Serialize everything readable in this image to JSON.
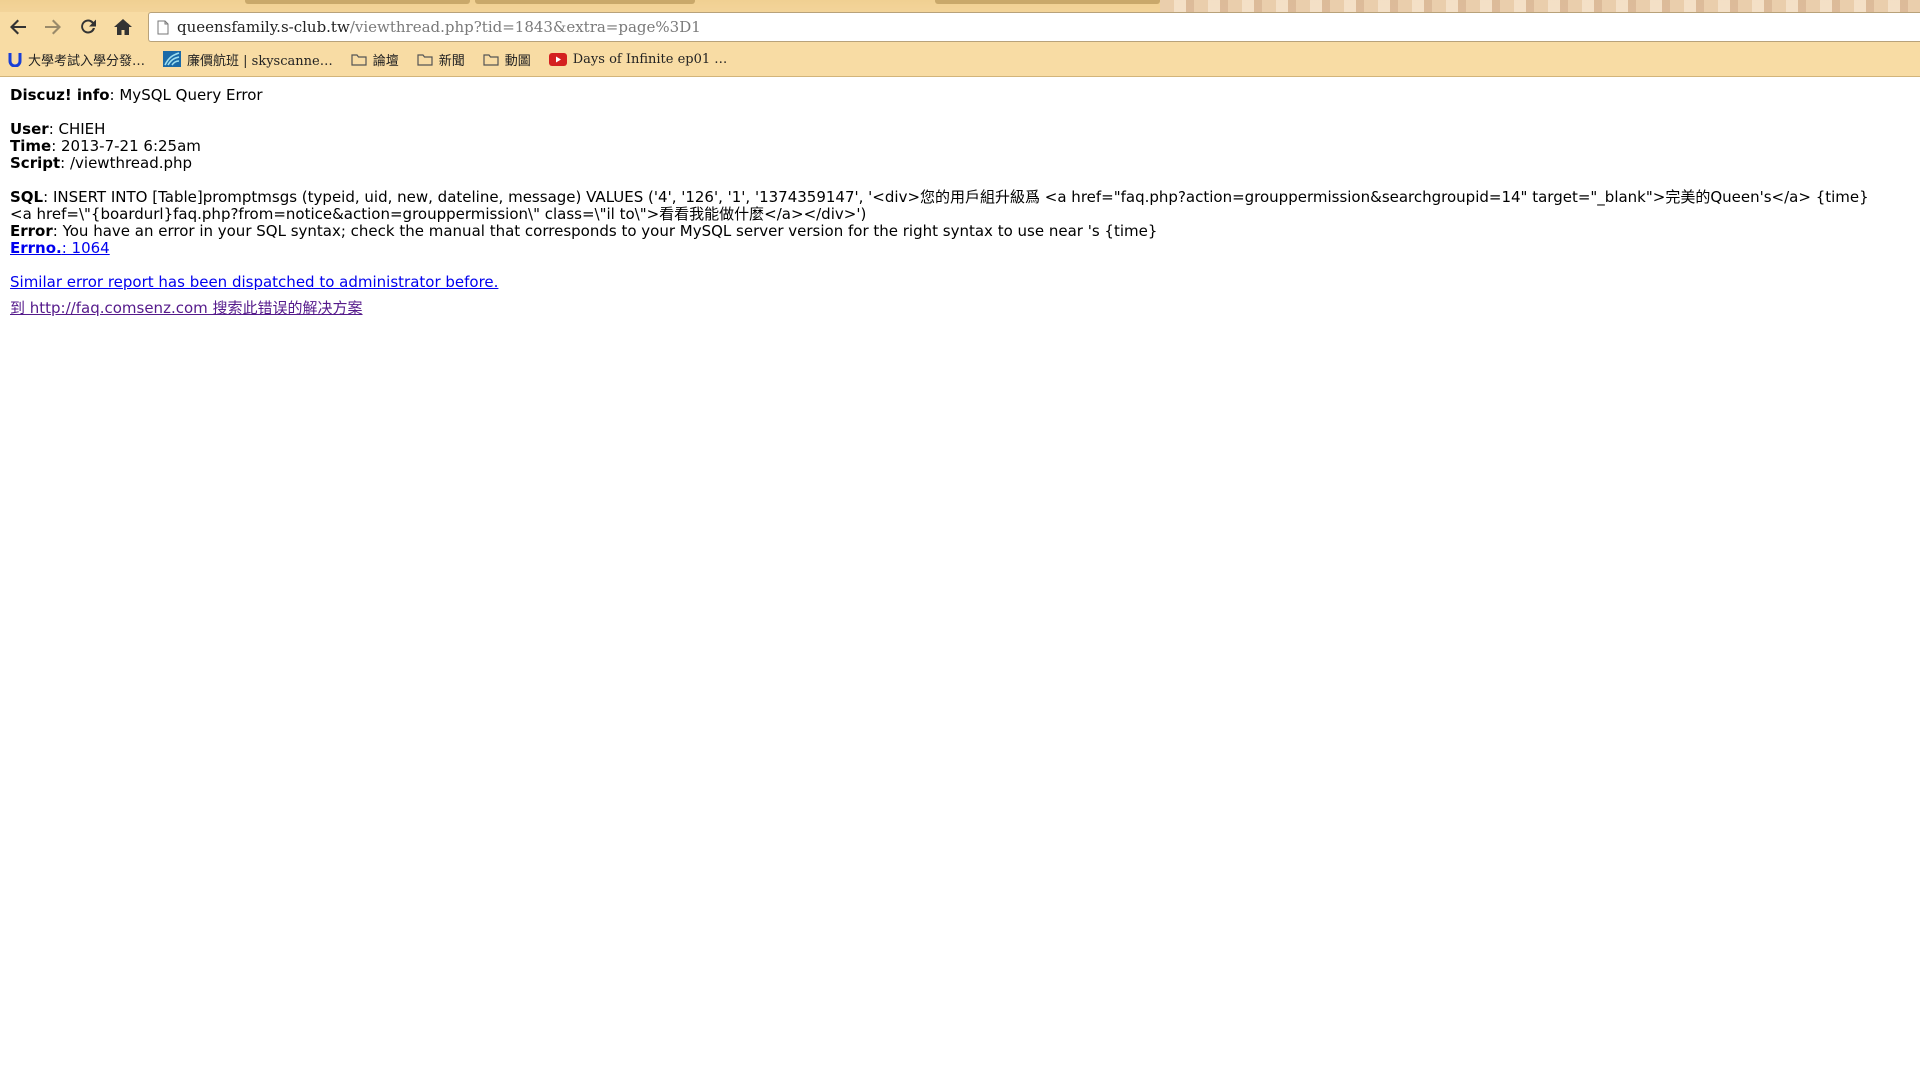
{
  "browser": {
    "url_host": "queensfamily.s-club.tw",
    "url_path": "/viewthread.php?tid=1843&extra=page%3D1",
    "bookmarks": [
      {
        "label": "大學考試入學分發…",
        "icon": "u-logo-icon"
      },
      {
        "label": "廉價航班 | skyscanne…",
        "icon": "skyscanner-icon"
      },
      {
        "label": "論壇",
        "icon": "folder-icon"
      },
      {
        "label": "新聞",
        "icon": "folder-icon"
      },
      {
        "label": "動圖",
        "icon": "folder-icon"
      },
      {
        "label": "Days of Infinite ep01 …",
        "icon": "youtube-icon"
      }
    ],
    "accent_color": "#f8dca4"
  },
  "error": {
    "title_label": "Discuz! info",
    "title_text": ": MySQL Query Error",
    "user_label": "User",
    "user_value": ": CHIEH",
    "time_label": "Time",
    "time_value": ": 2013-7-21 6:25am",
    "script_label": "Script",
    "script_value": ": /viewthread.php",
    "sql_label": "SQL",
    "sql_line1": ": INSERT INTO [Table]promptmsgs (typeid, uid, new, dateline, message) VALUES ('4', '126', '1', '1374359147', '<div>您的用戶組升級爲 <a href=\"faq.php?action=grouppermission&searchgroupid=14\" target=\"_blank\">完美的Queen's</a> {time}",
    "sql_line2": "<a href=\\\"{boardurl}faq.php?from=notice&action=grouppermission\\\" class=\\\"il to\\\">看看我能做什麼</a></div>')",
    "error_label": "Error",
    "error_value": ": You have an error in your SQL syntax; check the manual that corresponds to your MySQL server version for the right syntax to use near 's {time}",
    "errno_label": "Errno.",
    "errno_value": ": 1064",
    "dispatched_link": "Similar error report has been dispatched to administrator before.",
    "faq_link": "到 http://faq.comsenz.com 搜索此错误的解决方案"
  }
}
